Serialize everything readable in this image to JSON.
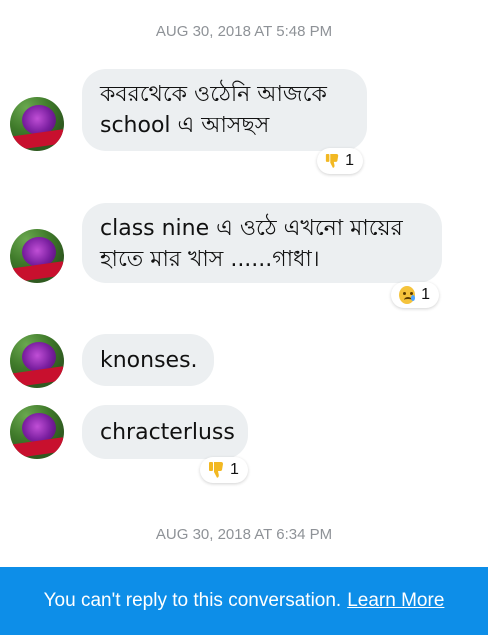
{
  "timestamps": [
    "AUG 30, 2018 AT 5:48 PM",
    "AUG 30, 2018 AT 6:34 PM"
  ],
  "messages": [
    {
      "lines": [
        "কবরথেকে ওঠেনি আজকে",
        "school এ আসছস"
      ],
      "reaction": {
        "icon": "thumbs-down-icon",
        "count": "1"
      }
    },
    {
      "lines": [
        "class nine এ ওঠে এখনো মায়ের",
        "হাতে মার খাস ......গাধা।"
      ],
      "reaction": {
        "icon": "crying-face-icon",
        "count": "1"
      }
    },
    {
      "lines": [
        "knonses."
      ]
    },
    {
      "lines": [
        "chracterluss"
      ],
      "reaction": {
        "icon": "thumbs-down-icon",
        "count": "1"
      }
    }
  ],
  "footer": {
    "message": "You can't reply to this conversation.",
    "link": "Learn More",
    "background": "#0d8ee8"
  },
  "colors": {
    "bubble": "#eceff1",
    "reaction_thumb": "#f2b822"
  }
}
